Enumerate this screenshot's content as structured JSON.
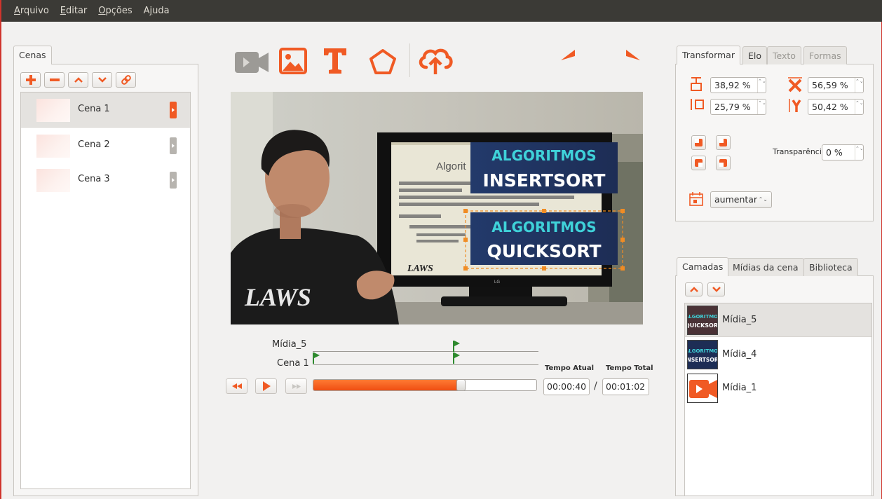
{
  "menu": {
    "items": [
      {
        "label": "Arquivo",
        "mnemonic": "A"
      },
      {
        "label": "Editar",
        "mnemonic": "E"
      },
      {
        "label": "Opções",
        "mnemonic": "O"
      },
      {
        "label": "Ajuda",
        "mnemonic": "j"
      }
    ]
  },
  "scenes_panel": {
    "tab_label": "Cenas",
    "buttons": [
      "add-icon",
      "remove-icon",
      "move-up-icon",
      "move-down-icon",
      "link-icon"
    ],
    "items": [
      {
        "label": "Cena 1",
        "selected": true
      },
      {
        "label": "Cena 2",
        "selected": false
      },
      {
        "label": "Cena 3",
        "selected": false
      }
    ]
  },
  "toolbar": {
    "icons": [
      "video-camera-icon",
      "image-icon",
      "text-icon",
      "pentagon-shape-icon",
      "cloud-upload-icon",
      "undo-icon",
      "redo-icon"
    ],
    "accent": "#f05a24",
    "disabled_color": "#9c9a96"
  },
  "preview": {
    "overlay_top_line1": "ALGORITMOS",
    "overlay_top_line2": "INSERTSORT",
    "overlay_bottom_line1": "ALGORITMOS",
    "overlay_bottom_line2": "QUICKSORT",
    "slide_title": "Algorit",
    "slide_logo": "LAWS",
    "shirt_logo": "LAWS",
    "tv_brand": "LG"
  },
  "timeline": {
    "tracks": [
      {
        "label": "Mídia_5"
      },
      {
        "label": "Cena 1"
      }
    ],
    "progress": 0.66,
    "current_time_label": "Tempo Atual",
    "current_time": "00:00:40",
    "separator": "/",
    "total_time_label": "Tempo Total",
    "total_time": "00:01:02"
  },
  "properties": {
    "tabs": [
      {
        "label": "Transformar",
        "state": "active"
      },
      {
        "label": "Elo",
        "state": "normal"
      },
      {
        "label": "Texto",
        "state": "disabled"
      },
      {
        "label": "Formas",
        "state": "disabled"
      }
    ],
    "width_value": "38,92 %",
    "x_value": "56,59 %",
    "height_value": "25,79 %",
    "y_value": "50,42 %",
    "transparency_label": "Transparência:",
    "transparency_value": "0 %",
    "animation_value": "aumentar",
    "combo_arrows": "⌃⌄"
  },
  "layers": {
    "tabs": [
      {
        "label": "Camadas",
        "state": "active"
      },
      {
        "label": "Mídias da cena",
        "state": "normal"
      },
      {
        "label": "Biblioteca",
        "state": "normal"
      }
    ],
    "items": [
      {
        "label": "Mídia_5",
        "thumb_line1": "ALGORITMOS",
        "thumb_line2": "QUICKSORT",
        "selected": true
      },
      {
        "label": "Mídia_4",
        "thumb_line1": "ALGORITMOS",
        "thumb_line2": "INSERTSORT",
        "selected": false
      },
      {
        "label": "Mídia_1",
        "selected": false
      }
    ]
  }
}
